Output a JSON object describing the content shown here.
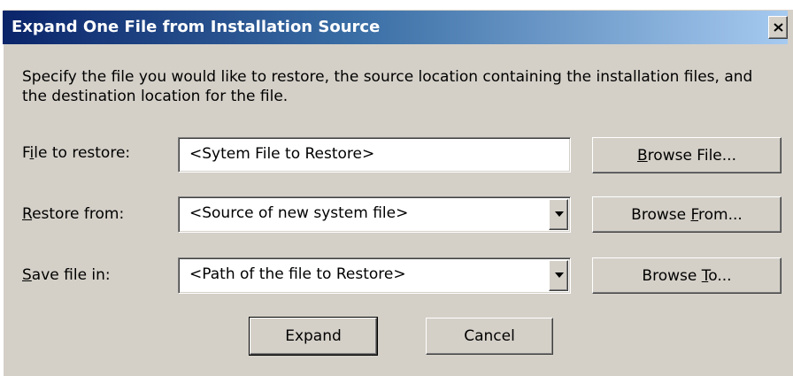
{
  "window": {
    "title": "Expand One File from Installation Source"
  },
  "description": "Specify the file you would like to restore, the source location containing the installation files, and the destination location for the file.",
  "rows": [
    {
      "label_pre": "F",
      "label_key": "i",
      "label_post": "le to restore:",
      "value": "<Sytem File to Restore>",
      "has_dropdown": false,
      "button_pre": "",
      "button_key": "B",
      "button_post": "rowse File..."
    },
    {
      "label_pre": "",
      "label_key": "R",
      "label_post": "estore from:",
      "value": "<Source of new system file>",
      "has_dropdown": true,
      "button_pre": "Browse ",
      "button_key": "F",
      "button_post": "rom..."
    },
    {
      "label_pre": "",
      "label_key": "S",
      "label_post": "ave file in:",
      "value": "<Path of the file to Restore>",
      "has_dropdown": true,
      "button_pre": "Browse ",
      "button_key": "T",
      "button_post": "o..."
    }
  ],
  "actions": {
    "expand_label": "Expand",
    "cancel_label": "Cancel"
  },
  "icons": {
    "close": "close-icon",
    "dropdown": "chevron-down-icon"
  },
  "colors": {
    "dialog_bg": "#d4d0c8",
    "title_start": "#0a246a",
    "title_end": "#a6caf0"
  }
}
